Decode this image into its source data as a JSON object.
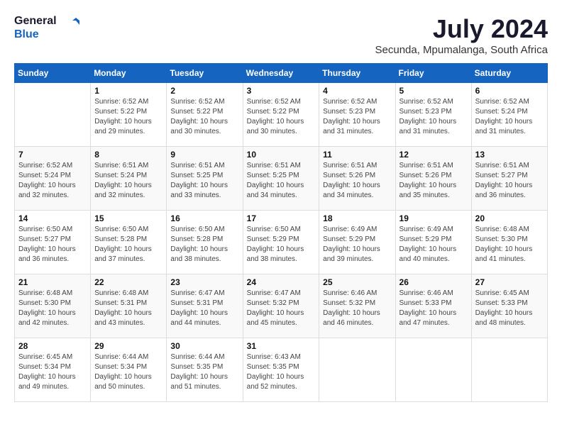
{
  "logo": {
    "line1": "General",
    "line2": "Blue"
  },
  "title": "July 2024",
  "subtitle": "Secunda, Mpumalanga, South Africa",
  "weekdays": [
    "Sunday",
    "Monday",
    "Tuesday",
    "Wednesday",
    "Thursday",
    "Friday",
    "Saturday"
  ],
  "weeks": [
    [
      {
        "day": "",
        "info": ""
      },
      {
        "day": "1",
        "info": "Sunrise: 6:52 AM\nSunset: 5:22 PM\nDaylight: 10 hours\nand 29 minutes."
      },
      {
        "day": "2",
        "info": "Sunrise: 6:52 AM\nSunset: 5:22 PM\nDaylight: 10 hours\nand 30 minutes."
      },
      {
        "day": "3",
        "info": "Sunrise: 6:52 AM\nSunset: 5:22 PM\nDaylight: 10 hours\nand 30 minutes."
      },
      {
        "day": "4",
        "info": "Sunrise: 6:52 AM\nSunset: 5:23 PM\nDaylight: 10 hours\nand 31 minutes."
      },
      {
        "day": "5",
        "info": "Sunrise: 6:52 AM\nSunset: 5:23 PM\nDaylight: 10 hours\nand 31 minutes."
      },
      {
        "day": "6",
        "info": "Sunrise: 6:52 AM\nSunset: 5:24 PM\nDaylight: 10 hours\nand 31 minutes."
      }
    ],
    [
      {
        "day": "7",
        "info": "Sunrise: 6:52 AM\nSunset: 5:24 PM\nDaylight: 10 hours\nand 32 minutes."
      },
      {
        "day": "8",
        "info": "Sunrise: 6:51 AM\nSunset: 5:24 PM\nDaylight: 10 hours\nand 32 minutes."
      },
      {
        "day": "9",
        "info": "Sunrise: 6:51 AM\nSunset: 5:25 PM\nDaylight: 10 hours\nand 33 minutes."
      },
      {
        "day": "10",
        "info": "Sunrise: 6:51 AM\nSunset: 5:25 PM\nDaylight: 10 hours\nand 34 minutes."
      },
      {
        "day": "11",
        "info": "Sunrise: 6:51 AM\nSunset: 5:26 PM\nDaylight: 10 hours\nand 34 minutes."
      },
      {
        "day": "12",
        "info": "Sunrise: 6:51 AM\nSunset: 5:26 PM\nDaylight: 10 hours\nand 35 minutes."
      },
      {
        "day": "13",
        "info": "Sunrise: 6:51 AM\nSunset: 5:27 PM\nDaylight: 10 hours\nand 36 minutes."
      }
    ],
    [
      {
        "day": "14",
        "info": "Sunrise: 6:50 AM\nSunset: 5:27 PM\nDaylight: 10 hours\nand 36 minutes."
      },
      {
        "day": "15",
        "info": "Sunrise: 6:50 AM\nSunset: 5:28 PM\nDaylight: 10 hours\nand 37 minutes."
      },
      {
        "day": "16",
        "info": "Sunrise: 6:50 AM\nSunset: 5:28 PM\nDaylight: 10 hours\nand 38 minutes."
      },
      {
        "day": "17",
        "info": "Sunrise: 6:50 AM\nSunset: 5:29 PM\nDaylight: 10 hours\nand 38 minutes."
      },
      {
        "day": "18",
        "info": "Sunrise: 6:49 AM\nSunset: 5:29 PM\nDaylight: 10 hours\nand 39 minutes."
      },
      {
        "day": "19",
        "info": "Sunrise: 6:49 AM\nSunset: 5:29 PM\nDaylight: 10 hours\nand 40 minutes."
      },
      {
        "day": "20",
        "info": "Sunrise: 6:48 AM\nSunset: 5:30 PM\nDaylight: 10 hours\nand 41 minutes."
      }
    ],
    [
      {
        "day": "21",
        "info": "Sunrise: 6:48 AM\nSunset: 5:30 PM\nDaylight: 10 hours\nand 42 minutes."
      },
      {
        "day": "22",
        "info": "Sunrise: 6:48 AM\nSunset: 5:31 PM\nDaylight: 10 hours\nand 43 minutes."
      },
      {
        "day": "23",
        "info": "Sunrise: 6:47 AM\nSunset: 5:31 PM\nDaylight: 10 hours\nand 44 minutes."
      },
      {
        "day": "24",
        "info": "Sunrise: 6:47 AM\nSunset: 5:32 PM\nDaylight: 10 hours\nand 45 minutes."
      },
      {
        "day": "25",
        "info": "Sunrise: 6:46 AM\nSunset: 5:32 PM\nDaylight: 10 hours\nand 46 minutes."
      },
      {
        "day": "26",
        "info": "Sunrise: 6:46 AM\nSunset: 5:33 PM\nDaylight: 10 hours\nand 47 minutes."
      },
      {
        "day": "27",
        "info": "Sunrise: 6:45 AM\nSunset: 5:33 PM\nDaylight: 10 hours\nand 48 minutes."
      }
    ],
    [
      {
        "day": "28",
        "info": "Sunrise: 6:45 AM\nSunset: 5:34 PM\nDaylight: 10 hours\nand 49 minutes."
      },
      {
        "day": "29",
        "info": "Sunrise: 6:44 AM\nSunset: 5:34 PM\nDaylight: 10 hours\nand 50 minutes."
      },
      {
        "day": "30",
        "info": "Sunrise: 6:44 AM\nSunset: 5:35 PM\nDaylight: 10 hours\nand 51 minutes."
      },
      {
        "day": "31",
        "info": "Sunrise: 6:43 AM\nSunset: 5:35 PM\nDaylight: 10 hours\nand 52 minutes."
      },
      {
        "day": "",
        "info": ""
      },
      {
        "day": "",
        "info": ""
      },
      {
        "day": "",
        "info": ""
      }
    ]
  ]
}
